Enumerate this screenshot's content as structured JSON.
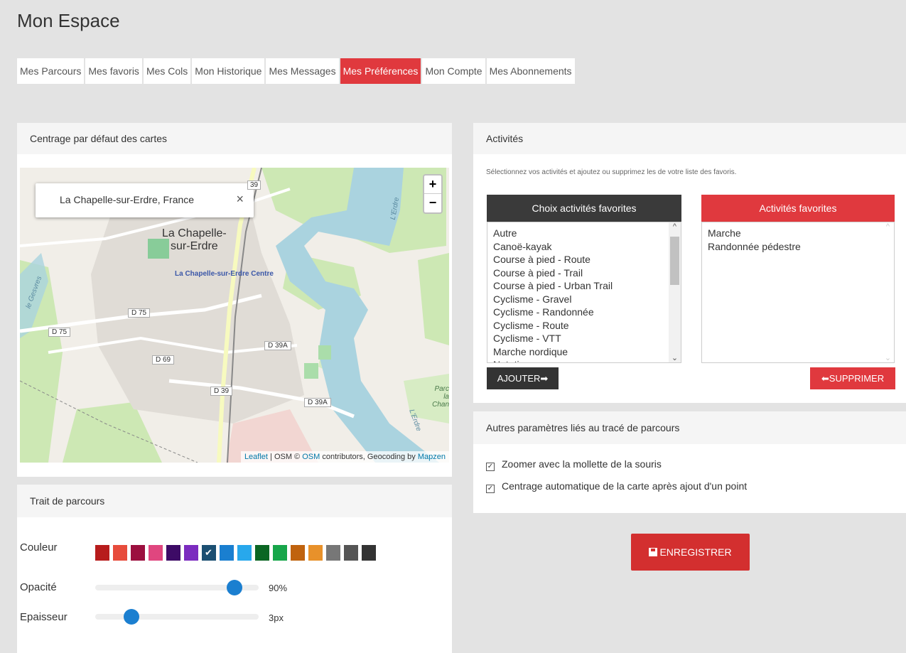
{
  "title": "Mon Espace",
  "tabs": [
    {
      "label": "Mes Parcours"
    },
    {
      "label": "Mes favoris"
    },
    {
      "label": "Mes Cols"
    },
    {
      "label": "Mon Historique"
    },
    {
      "label": "Mes Messages"
    },
    {
      "label": "Mes Préférences",
      "active": true
    },
    {
      "label": "Mon Compte"
    },
    {
      "label": "Mes Abonnements"
    }
  ],
  "centrage": {
    "title": "Centrage par défaut des cartes",
    "search_value": "La Chapelle-sur-Erdre, France",
    "close_symbol": "×",
    "zoom_in": "+",
    "zoom_out": "−",
    "map_labels": {
      "town_line1": "La Chapelle-",
      "town_line2": "sur-Erdre",
      "centre": "La Chapelle-sur-Erdre Centre",
      "d75a": "D 75",
      "d75b": "D 75",
      "d69": "D 69",
      "d39": "D 39",
      "d39a1": "D 39A",
      "d39a2": "D 39A",
      "parc1": "Parc",
      "parc2": "la Chan",
      "erdre1": "L'Erdre",
      "erdre2": "L'Erdre",
      "gesvres": "le Gesvres",
      "num9": "39"
    },
    "attribution": {
      "leaflet": "Leaflet",
      "sep": " | OSM © ",
      "osm": "OSM",
      "mid": " contributors, Geocoding by ",
      "mapzen": "Mapzen"
    }
  },
  "trait": {
    "title": "Trait de parcours",
    "couleur_label": "Couleur",
    "opacite_label": "Opacité",
    "opacite_value": "90%",
    "opacite_fraction": 0.9,
    "epaisseur_label": "Epaisseur",
    "epaisseur_value": "3px",
    "epaisseur_fraction": 0.22,
    "colors": [
      "#b71c1c",
      "#e74c3c",
      "#9c0f3f",
      "#e0467f",
      "#3d0b66",
      "#7b2bbf",
      "#1b4f72",
      "#1a7fd0",
      "#28a8ec",
      "#0b6623",
      "#17a64a",
      "#c0630e",
      "#e8912a",
      "#777777",
      "#555555",
      "#333333"
    ],
    "selected_color_index": 6
  },
  "activites": {
    "title": "Activités",
    "hint": "Sélectionnez vos activités et ajoutez ou supprimez les de votre liste des favoris.",
    "choix_title": "Choix activités favorites",
    "favorites_title": "Activités favorites",
    "choix_items": [
      "Autre",
      "Canoë-kayak",
      "Course à pied - Route",
      "Course à pied - Trail",
      "Course à pied - Urban Trail",
      "Cyclisme - Gravel",
      "Cyclisme - Randonnée",
      "Cyclisme - Route",
      "Cyclisme - VTT",
      "Marche nordique",
      "Natation"
    ],
    "favorite_items": [
      "Marche",
      "Randonnée pédestre"
    ],
    "add_button": "AJOUTER",
    "add_icon": "➡",
    "remove_button": "SUPPRIMER",
    "remove_icon": "⬅",
    "scroll_up": "^",
    "scroll_down": "⌄"
  },
  "autres": {
    "title": "Autres paramètres liés au tracé de parcours",
    "option1": "Zoomer avec la mollette de la souris",
    "option2": "Centrage automatique de la carte après ajout d'un point",
    "check_mark": "✓"
  },
  "save_button": "ENREGISTRER",
  "save_icon": "floppy-disk-icon",
  "colors": {
    "accent": "#e0393e",
    "dark": "#333333",
    "button_red": "#d32f2f",
    "slider": "#1b7fd0"
  }
}
